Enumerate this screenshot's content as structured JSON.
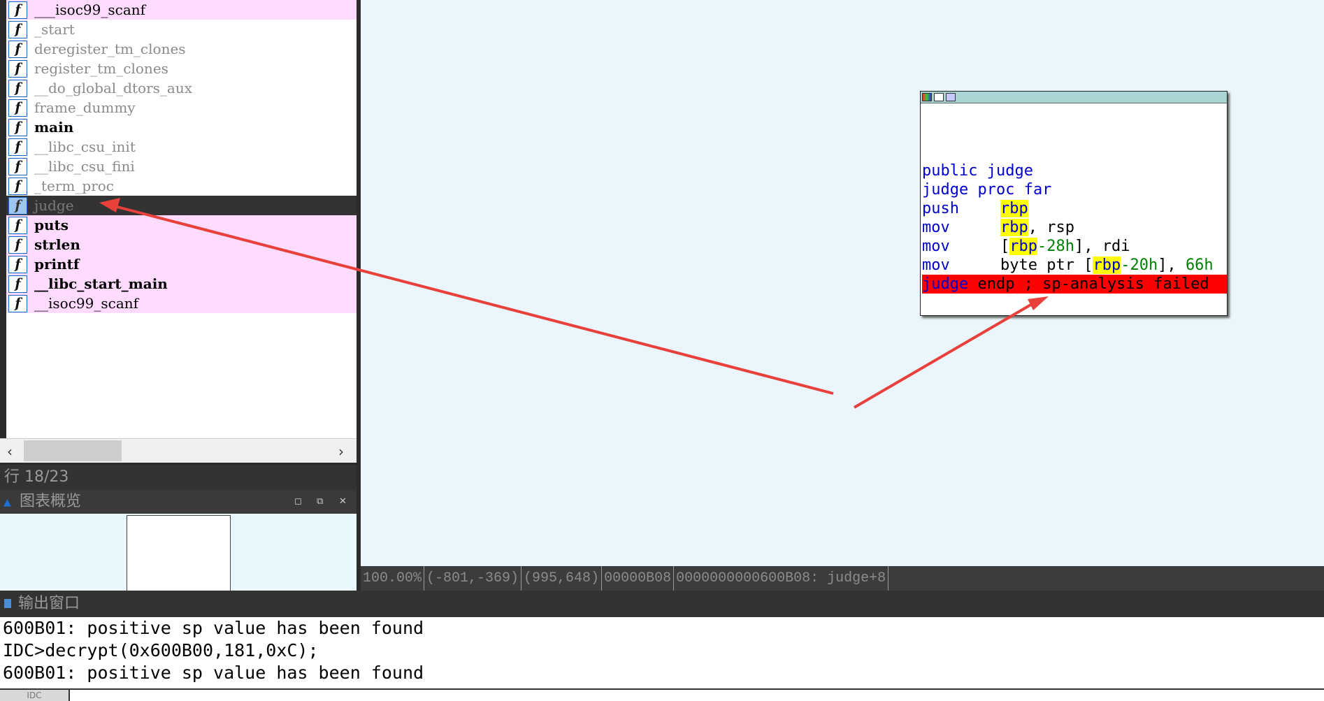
{
  "function_list": {
    "items": [
      {
        "name": "___isoc99_scanf",
        "style": "pink"
      },
      {
        "name": "_start",
        "style": "gray"
      },
      {
        "name": "deregister_tm_clones",
        "style": "gray"
      },
      {
        "name": "register_tm_clones",
        "style": "gray"
      },
      {
        "name": "__do_global_dtors_aux",
        "style": "gray"
      },
      {
        "name": "frame_dummy",
        "style": "gray"
      },
      {
        "name": "main",
        "style": "bold"
      },
      {
        "name": "__libc_csu_init",
        "style": "gray"
      },
      {
        "name": "__libc_csu_fini",
        "style": "gray"
      },
      {
        "name": "_term_proc",
        "style": "gray"
      },
      {
        "name": "judge",
        "style": "selected"
      },
      {
        "name": "puts",
        "style": "pink"
      },
      {
        "name": "strlen",
        "style": "pink"
      },
      {
        "name": "printf",
        "style": "pink"
      },
      {
        "name": "__libc_start_main",
        "style": "pink"
      },
      {
        "name": "__isoc99_scanf",
        "style": "pink"
      }
    ],
    "function_icon": "f-icon",
    "scroll_left": "‹",
    "scroll_right": "›",
    "status": "行 18/23"
  },
  "graph_overview": {
    "title": "图表概览",
    "title_icon": "graph-icon"
  },
  "asm_node": {
    "lines": [
      {
        "mnemonic": "public",
        "operand": "judge"
      },
      {
        "text": "judge proc far"
      },
      {
        "mnemonic": "push",
        "reg": "rbp"
      },
      {
        "mnemonic": "mov",
        "reg": "rbp",
        "rest": ", rsp"
      },
      {
        "mnemonic": "mov",
        "pre": "[",
        "reg": "rbp",
        "num": "-28h",
        "rest": "], rdi"
      },
      {
        "mnemonic": "mov",
        "pre": "byte ptr [",
        "reg": "rbp",
        "num": "-20h",
        "rest": "], ",
        "num2": "66h"
      },
      {
        "error_name": "judge",
        "error_rest": " endp ; sp-analysis failed"
      }
    ]
  },
  "graph_status": {
    "zoom": "100.00%",
    "coords1": "(-801,-369)",
    "coords2": "(995,648)",
    "offset": "00000B08",
    "address": "0000000000600B08: judge+8"
  },
  "output": {
    "title": "输出窗口",
    "lines": [
      "600B01: positive sp value has been found",
      "IDC>decrypt(0x600B00,181,0xC);",
      "600B01: positive sp value has been found"
    ],
    "idc_tab": "IDC"
  },
  "colors": {
    "pink_row": "#ffdcff",
    "selected_row": "#333333",
    "graph_bg": "#eaf6fb",
    "error_line": "#ff0000",
    "register_highlight": "#ffff00",
    "arrow": "#e8403a"
  }
}
